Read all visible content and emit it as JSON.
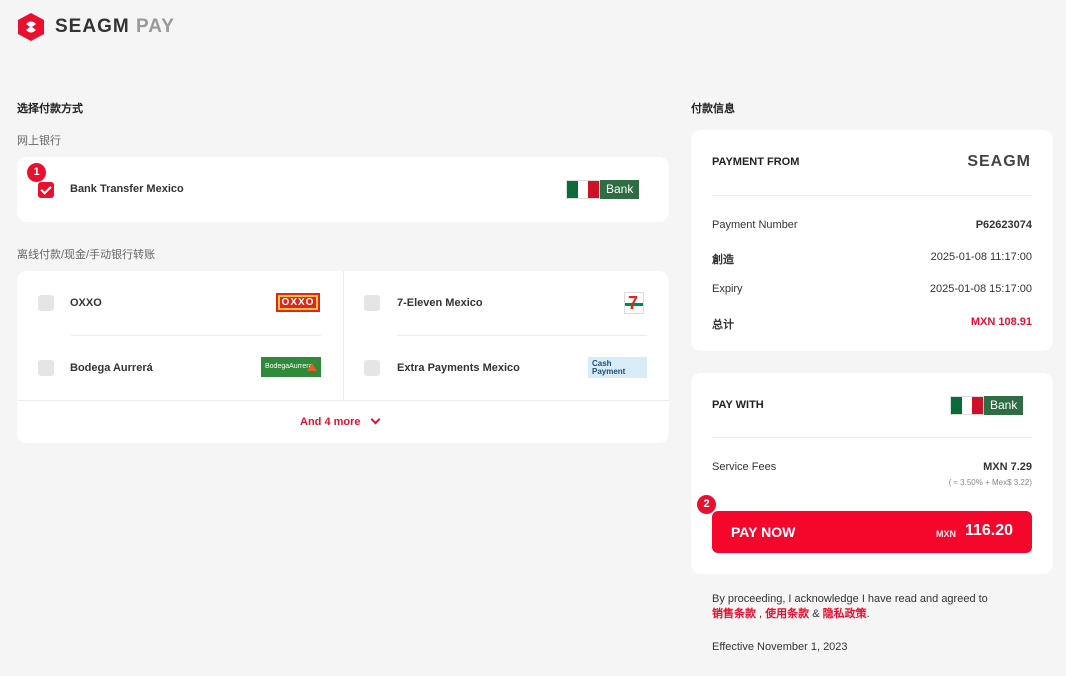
{
  "brand": {
    "name": "SEAGM",
    "suffix": "PAY",
    "small_logo": "SEAGM",
    "accent": "#e8102e"
  },
  "left": {
    "title": "选择付款方式",
    "online_banking": {
      "subtitle": "网上银行",
      "items": [
        {
          "label": "Bank Transfer Mexico",
          "checked": true,
          "logo_text": "Bank",
          "badge": "1"
        }
      ]
    },
    "offline": {
      "subtitle": "离线付款/现金/手动银行转账",
      "items": [
        {
          "label": "OXXO",
          "logo_text": "OXXO"
        },
        {
          "label": "7-Eleven Mexico",
          "logo_text": "7"
        },
        {
          "label": "Bodega Aurrerá",
          "logo_text": "BodegaAurrera"
        },
        {
          "label": "Extra Payments Mexico",
          "logo_text_1": "Cash",
          "logo_text_2": "Payment"
        }
      ],
      "more_label": "And 4 more"
    }
  },
  "right": {
    "title": "付款信息",
    "payment_from": {
      "heading": "PAYMENT FROM",
      "rows": [
        {
          "label": "Payment Number",
          "value": "P62623074"
        },
        {
          "label": "創造",
          "value": "2025-01-08 11:17:00"
        },
        {
          "label": "Expiry",
          "value": "2025-01-08 15:17:00"
        },
        {
          "label": "总计",
          "value": "MXN 108.91"
        }
      ]
    },
    "pay_with": {
      "heading": "PAY WITH",
      "logo_text": "Bank",
      "fee_label": "Service Fees",
      "fee_value": "MXN 7.29",
      "fee_note": "( ≈ 3.50% + Mex$ 3.22)",
      "badge": "2",
      "button_label": "PAY NOW",
      "button_currency": "MXN",
      "button_amount": "116.20"
    },
    "terms": {
      "text": "By proceeding, I acknowledge I have read and agreed to",
      "link1": "销售条款",
      "sep1": " , ",
      "link2": "使用条款",
      "sep2": " & ",
      "link3": "隐私政策",
      "end": ".",
      "effective": "Effective November 1, 2023"
    }
  }
}
